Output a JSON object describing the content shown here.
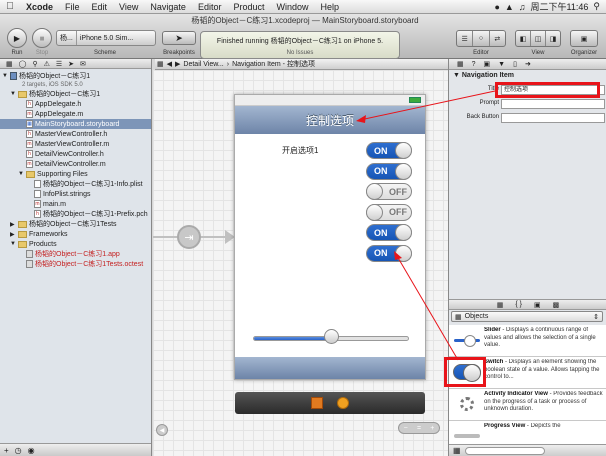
{
  "menubar": {
    "app": "Xcode",
    "items": [
      "File",
      "Edit",
      "View",
      "Navigate",
      "Editor",
      "Product",
      "Window",
      "Help"
    ],
    "clock": "周二下午11:46"
  },
  "toolbar": {
    "window_title": "杨韬的Object－C练习1.xcodeproj — MainStoryboard.storyboard",
    "run_label": "Run",
    "stop_label": "Stop",
    "scheme_target": "杨...",
    "scheme_device": "iPhone 5.0 Sim...",
    "scheme_label": "Scheme",
    "breakpoints_label": "Breakpoints",
    "activity_message": "Finished running 杨韬的Object－C练习1 on iPhone 5.",
    "activity_sub": "No Issues",
    "editor_label": "Editor",
    "view_label": "View",
    "organizer_label": "Organizer"
  },
  "jumpbar": {
    "crumbs": [
      "Detail View...",
      "Navigation Item - 控制选项"
    ]
  },
  "navigator": {
    "project_name": "杨韬的Object－C练习1",
    "project_sub": "2 targets, iOS SDK 5.0",
    "items": [
      {
        "label": "杨韬的Object－C练习1",
        "kind": "folder",
        "indent": 1,
        "open": true
      },
      {
        "label": "AppDelegate.h",
        "kind": "h",
        "indent": 2
      },
      {
        "label": "AppDelegate.m",
        "kind": "m",
        "indent": 2
      },
      {
        "label": "MainStoryboard.storyboard",
        "kind": "sb",
        "indent": 2,
        "selected": true
      },
      {
        "label": "MasterViewController.h",
        "kind": "h",
        "indent": 2
      },
      {
        "label": "MasterViewController.m",
        "kind": "m",
        "indent": 2
      },
      {
        "label": "DetailViewController.h",
        "kind": "h",
        "indent": 2
      },
      {
        "label": "DetailViewController.m",
        "kind": "m",
        "indent": 2
      },
      {
        "label": "Supporting Files",
        "kind": "folder",
        "indent": 2,
        "open": true
      },
      {
        "label": "杨韬的Object－C练习1-Info.plist",
        "kind": "plist",
        "indent": 3
      },
      {
        "label": "InfoPlist.strings",
        "kind": "strings",
        "indent": 3
      },
      {
        "label": "main.m",
        "kind": "m",
        "indent": 3
      },
      {
        "label": "杨韬的Object－C练习1-Prefix.pch",
        "kind": "h",
        "indent": 3
      },
      {
        "label": "杨韬的Object－C练习1Tests",
        "kind": "folder",
        "indent": 1,
        "open": false
      },
      {
        "label": "Frameworks",
        "kind": "folder",
        "indent": 1,
        "open": false
      },
      {
        "label": "Products",
        "kind": "folder",
        "indent": 1,
        "open": true
      },
      {
        "label": "杨韬的Object－C练习1.app",
        "kind": "app",
        "indent": 2,
        "red": true
      },
      {
        "label": "杨韬的Object－C练习1Tests.octest",
        "kind": "app",
        "indent": 2,
        "red": true
      }
    ]
  },
  "canvas": {
    "nav_title": "控制选项",
    "row_label": "开启选项1",
    "switches": [
      {
        "label": "ON",
        "on": true
      },
      {
        "label": "ON",
        "on": true
      },
      {
        "label": "OFF",
        "on": false
      },
      {
        "label": "OFF",
        "on": false
      },
      {
        "label": "ON",
        "on": true
      },
      {
        "label": "ON",
        "on": true
      }
    ],
    "slider_value": 0.5
  },
  "inspector": {
    "section": "Navigation Item",
    "title_label": "Title",
    "title_value": "控制选项",
    "prompt_label": "Prompt",
    "prompt_value": "",
    "back_label": "Back Button",
    "back_value": "",
    "library_scope": "Objects",
    "library": [
      {
        "name": "Slider",
        "desc": " - Displays a continuous range of values and allows the selection of a single value.",
        "icon": "slider"
      },
      {
        "name": "Switch",
        "desc": " - Displays an element showing the boolean state of a value. Allows tapping the control to...",
        "icon": "switch"
      },
      {
        "name": "Activity Indicator View",
        "desc": " - Provides feedback on the progress of a task or process of unknown duration.",
        "icon": "spinner"
      },
      {
        "name": "Progress View",
        "desc": " - Depicts the",
        "icon": "progress"
      }
    ]
  },
  "colors": {
    "annotation_red": "#e8141a",
    "switch_blue": "#1f62c6",
    "navbar_blue": "#7f95b8"
  }
}
